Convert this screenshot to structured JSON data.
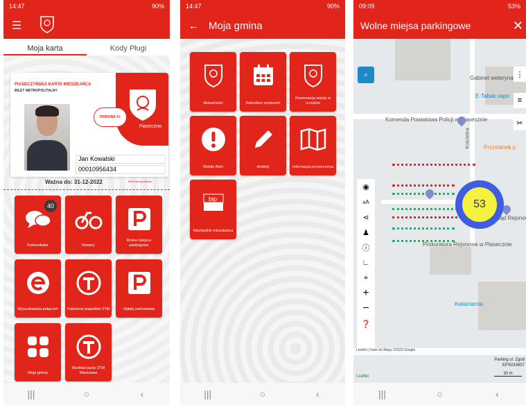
{
  "phone1": {
    "status_time": "14:47",
    "status_right": "90%",
    "tabs": [
      "Moja karta",
      "Kody Pługi"
    ],
    "card": {
      "title": "PIASECZYŃSKA KARTA MIESZKAŃCA",
      "subtitle": "BILET METROPOLITALNY",
      "family_badge": "RODZINA 3+",
      "city": "Piaseczno",
      "name": "Jan Kowalski",
      "number": "00010956434"
    },
    "valid_until": "Ważna do: 31-12-2022",
    "bilet_link": "Bilet Metropolitalny",
    "tiles": [
      {
        "label": "Komunikator",
        "badge": "40"
      },
      {
        "label": "Rowery"
      },
      {
        "label": "Wolne miejsca parkingowe"
      },
      {
        "label": "Wyszukiwarka połączeń"
      },
      {
        "label": "Położenie pojazdów ZTM"
      },
      {
        "label": "Opłaty parkowania"
      },
      {
        "label": "Moja gmina"
      },
      {
        "label": "Rozkład jazdy ZTM Warszawa"
      }
    ]
  },
  "phone2": {
    "status_time": "14:47",
    "status_right": "90%",
    "title": "Moja gmina",
    "tiles": [
      {
        "label": "Aktualności"
      },
      {
        "label": "Kalendarz wydarzeń"
      },
      {
        "label": "Rezerwacja wizyty w urzędzie"
      },
      {
        "label": "Mobile Alert"
      },
      {
        "label": "Ankiety"
      },
      {
        "label": "Informacja przestrzenna"
      },
      {
        "label": "Niezbędnik mieszkańca"
      }
    ]
  },
  "phone3": {
    "status_time": "09:09",
    "status_right": "53%",
    "title": "Wolne miejsa parkingowe",
    "cluster_count": "53",
    "map_labels": {
      "komenda": "Komenda Powiatowa Policji w Piasecznie",
      "gabinet": "Gabinet weterynaryjny",
      "etabak": "E-Tabak vapo",
      "przystanek": "Przystanek p",
      "sad": "Sąd Rejonowy w Piasecznie",
      "prokuratura": "Prokuratura Rejonowa w Piasecznie",
      "kwiaciarnia": "Kwiaciarnia",
      "koscielna": "Kościelna"
    },
    "attribution": "Leaflet | Dane do Mapy ©2023 Google",
    "parking_info": [
      "Parking ul. Zgod",
      "EPS033657"
    ],
    "scale": "30 m",
    "leaflet": "Leaflet"
  },
  "colors": {
    "brand_red": "#e1251b",
    "map_blue": "#1e88c8",
    "cluster_outer": "#3f5de0",
    "cluster_inner": "#f4f23e"
  }
}
